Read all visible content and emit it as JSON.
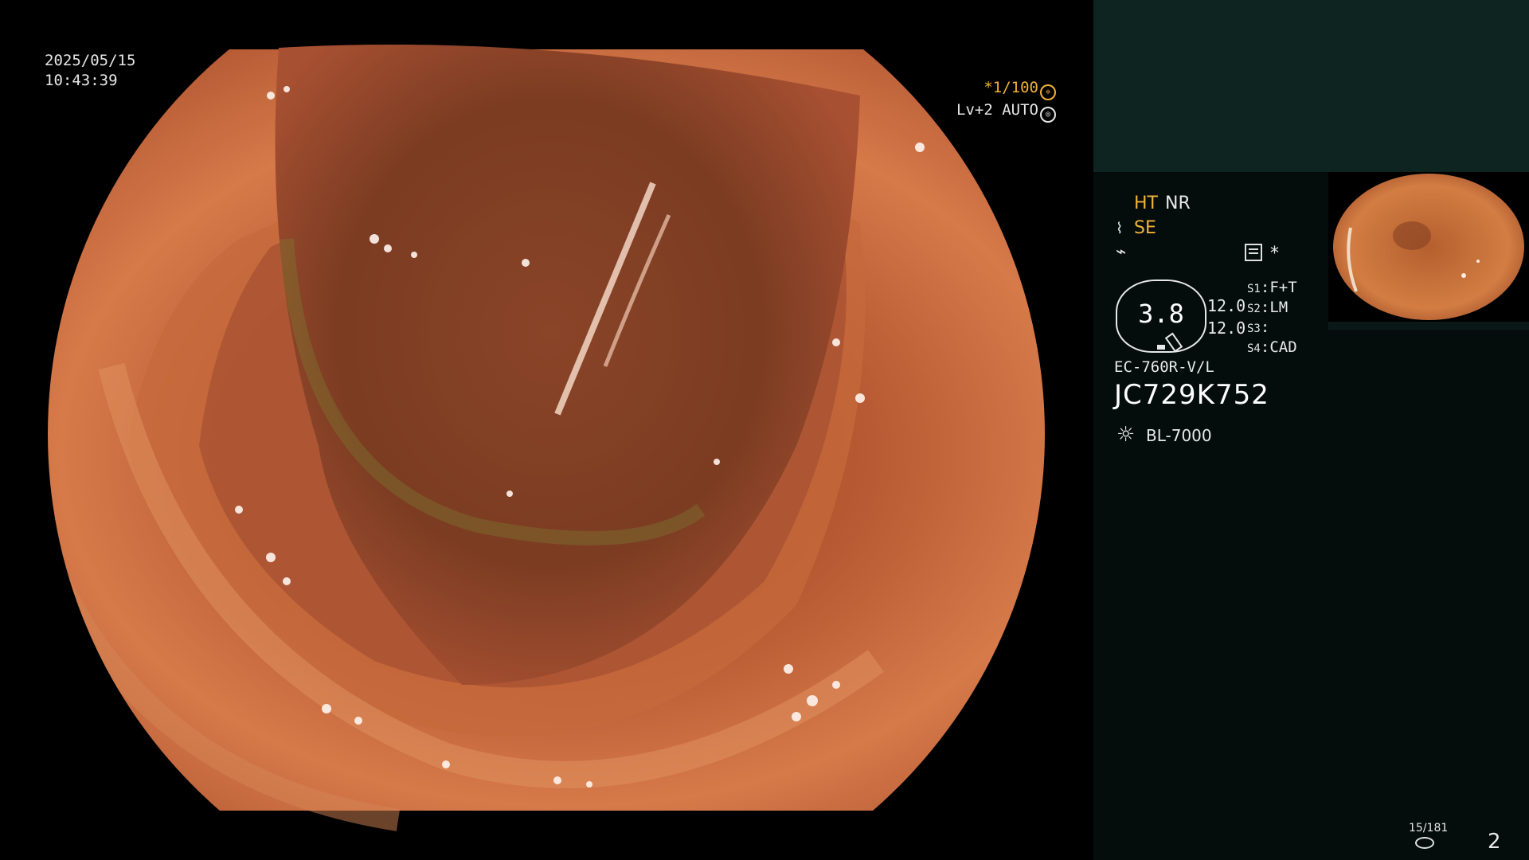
{
  "osd": {
    "date": "2025/05/15",
    "time": "10:43:39",
    "shutter": "*1/100",
    "level": "Lv+2 AUTO",
    "shutter_icon": "aperture-icon",
    "auto_icon": "iris-icon"
  },
  "panel": {
    "ht": "HT",
    "nr": "NR",
    "se_icon": "structure-enhancement-icon",
    "se": "SE",
    "flash_icon": "flash-icon",
    "panel_icon": "memory-card-icon",
    "star": "*",
    "gauge_value": "3.8",
    "gauge_value_2": "12.0",
    "gauge_value_3": "12.0",
    "slots": [
      {
        "key": "S1",
        "value": "F+T"
      },
      {
        "key": "S2",
        "value": "LM"
      },
      {
        "key": "S3",
        "value": ""
      },
      {
        "key": "S4",
        "value": "CAD"
      }
    ],
    "scope_model": "EC-760R-V/L",
    "serial": "JC729K752",
    "light_icon": "light-source-icon",
    "light_model": "BL-7000",
    "record_counter": "15/181",
    "page_number": "2"
  },
  "colors": {
    "accent": "#f0b23a",
    "panel_bg": "#040d0c",
    "panel_top": "#0d2421",
    "tissue": "#c86a3a"
  }
}
